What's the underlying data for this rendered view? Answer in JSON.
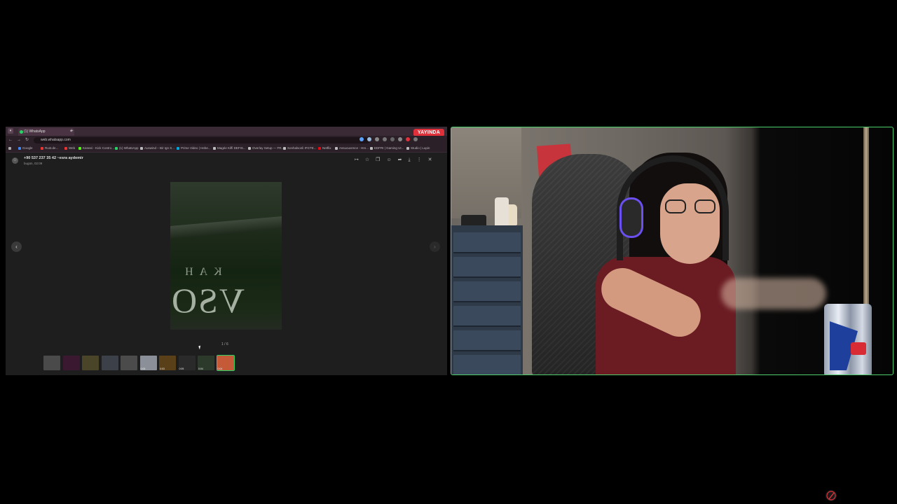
{
  "browser": {
    "tab_title": "(1) WhatsApp",
    "new_tab_symbol": "+",
    "url": "web.whatsapp.com",
    "live_badge": "YAYINDA",
    "bookmarks": [
      "Google",
      "Rust.de...",
      "Web",
      "Keeeei - Kick Contro...",
      "(1) WhatsApp",
      "Auswind – Bir Ign S...",
      "Prime Video | Hebe...",
      "Magée Kiffi DEFIS...",
      "Overlay Setup — FR...",
      "Sonhalsonli IFGTE...",
      "Netflix",
      "Assuouvence - Hre...",
      "EDFRI | Gaming Ut...",
      "Studio | Lupin"
    ]
  },
  "viewer": {
    "sender": "+90 537 237 35 42 ~esra aydemir",
    "time": "bugün, 02:09",
    "counter": "1 / 6",
    "prev_symbol": "‹",
    "next_symbol": "›",
    "tools": [
      "↦",
      "☆",
      "❐",
      "☺",
      "➦",
      "⤓",
      "⋮",
      "✕"
    ],
    "photo_sign_small": "KAH",
    "photo_sign_large": "VSO",
    "thumbnails": [
      {
        "color": "#4a4a4a",
        "meta": ""
      },
      {
        "color": "#3a1830",
        "meta": ""
      },
      {
        "color": "#4a4428",
        "meta": ""
      },
      {
        "color": "#3c4048",
        "meta": ""
      },
      {
        "color": "#4b4b4b",
        "meta": ""
      },
      {
        "color": "#8a8f98",
        "meta": "0:05"
      },
      {
        "color": "#5a4018",
        "meta": "0:03"
      },
      {
        "color": "#2a2a2a",
        "meta": "0:05"
      },
      {
        "color": "#2c3a2c",
        "meta": "0:04"
      },
      {
        "color": "#c45a38",
        "meta": "0:04"
      }
    ]
  },
  "colors": {
    "live_red": "#e0303a",
    "webcam_border": "#4ecf6c",
    "whatsapp_green": "#25d366"
  }
}
